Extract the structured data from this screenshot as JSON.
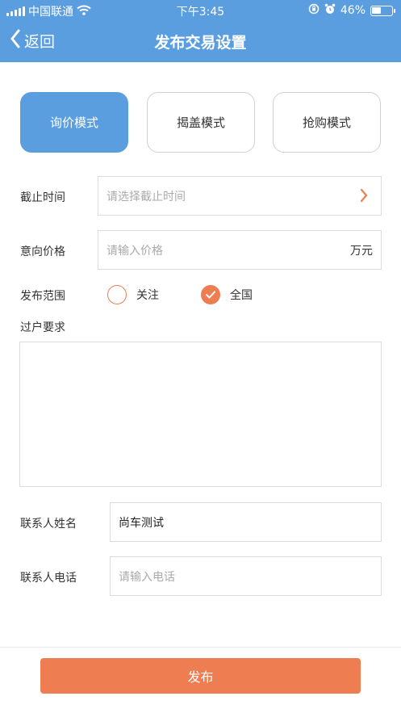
{
  "status_bar": {
    "carrier": "中国联通",
    "time": "下午3:45",
    "battery": "46%",
    "battery_level": 0.46
  },
  "nav": {
    "back_label": "返回",
    "title": "发布交易设置"
  },
  "modes": [
    {
      "label": "询价模式",
      "active": true
    },
    {
      "label": "揭盖模式",
      "active": false
    },
    {
      "label": "抢购模式",
      "active": false
    }
  ],
  "form": {
    "deadline": {
      "label": "截止时间",
      "placeholder": "请选择截止时间"
    },
    "price": {
      "label": "意向价格",
      "placeholder": "请输入价格",
      "unit": "万元"
    },
    "scope": {
      "label": "发布范围",
      "options": [
        {
          "label": "关注",
          "checked": false
        },
        {
          "label": "全国",
          "checked": true
        }
      ]
    },
    "transfer": {
      "label": "过户要求",
      "value": ""
    },
    "contact_name": {
      "label": "联系人姓名",
      "value": "尚车测试"
    },
    "contact_phone": {
      "label": "联系人电话",
      "placeholder": "请输入电话"
    }
  },
  "submit_label": "发布",
  "colors": {
    "header": "#5b9ee0",
    "accent": "#ee7d52"
  }
}
